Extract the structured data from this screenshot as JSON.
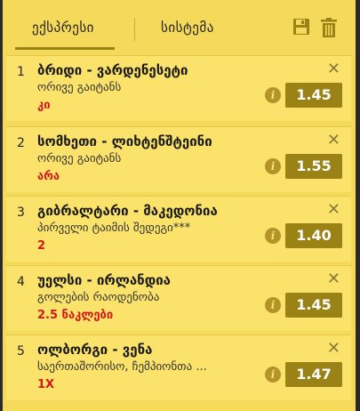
{
  "tabs": {
    "express": "ექსპრესი",
    "system": "სისტემა"
  },
  "icons": {
    "save": "save-icon",
    "delete": "trash-icon"
  },
  "bets": [
    {
      "num": "1",
      "title": "ბრიდი - ვარდენესეტი",
      "market": "ორივე გაიტანს",
      "selection": "კი",
      "odds": "1.45"
    },
    {
      "num": "2",
      "title": "სომხეთი - ლიხტენშტეინი",
      "market": "ორივე გაიტანს",
      "selection": "არა",
      "odds": "1.55"
    },
    {
      "num": "3",
      "title": "გიბრალტარი - მაკედონია",
      "market": "პირველი ტაიმის შედეგი***",
      "selection": "2",
      "odds": "1.40"
    },
    {
      "num": "4",
      "title": "უელსი - ირლანდია",
      "market": "გოლების რაოდენობა",
      "selection": "2.5 ნაკლები",
      "odds": "1.45"
    },
    {
      "num": "5",
      "title": "ოლბორგი - ვენა",
      "market": "საერთაშორისო, ჩემპიონთა ...",
      "selection": "1X",
      "odds": "1.47"
    }
  ],
  "close_glyph": "✕",
  "info_glyph": "i",
  "colors": {
    "panel": "#f5d95a",
    "card": "#fbe36b",
    "odds_bg": "#9a8217",
    "selection": "#d01a1a"
  }
}
